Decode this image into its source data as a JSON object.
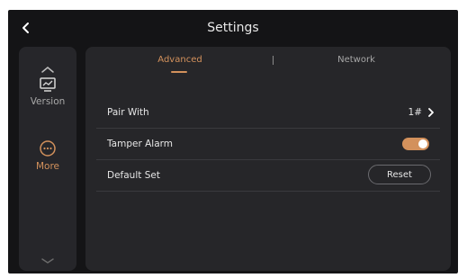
{
  "header": {
    "title": "Settings"
  },
  "sidebar": {
    "items": [
      {
        "label": "Version",
        "icon": "monitor-icon"
      },
      {
        "label": "More",
        "icon": "more-icon"
      }
    ],
    "active_color": "#d3915c"
  },
  "tabs": [
    {
      "label": "Advanced",
      "selected": true
    },
    {
      "label": "Network",
      "selected": false
    }
  ],
  "rows": {
    "pair_with": {
      "label": "Pair With",
      "value": "1#"
    },
    "tamper_alarm": {
      "label": "Tamper Alarm",
      "enabled": true
    },
    "default_set": {
      "label": "Default Set",
      "button": "Reset"
    }
  },
  "colors": {
    "accent": "#d3915c",
    "background": "#141416",
    "panel": "#262629"
  }
}
